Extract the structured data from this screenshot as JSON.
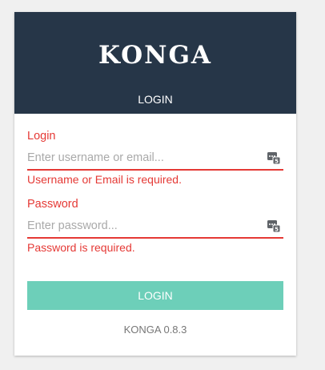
{
  "header": {
    "logo": "KONGA",
    "title": "LOGIN"
  },
  "login_field": {
    "label": "Login",
    "placeholder": "Enter username or email...",
    "value": "",
    "error": "Username or Email is required.",
    "icon": "password-manager-icon"
  },
  "password_field": {
    "label": "Password",
    "placeholder": "Enter password...",
    "value": "",
    "error": "Password is required.",
    "icon": "password-manager-icon"
  },
  "submit_label": "LOGIN",
  "version": "KONGA 0.8.3",
  "colors": {
    "header_bg": "#263648",
    "error": "#e53935",
    "button_bg": "#6dcfb9"
  }
}
